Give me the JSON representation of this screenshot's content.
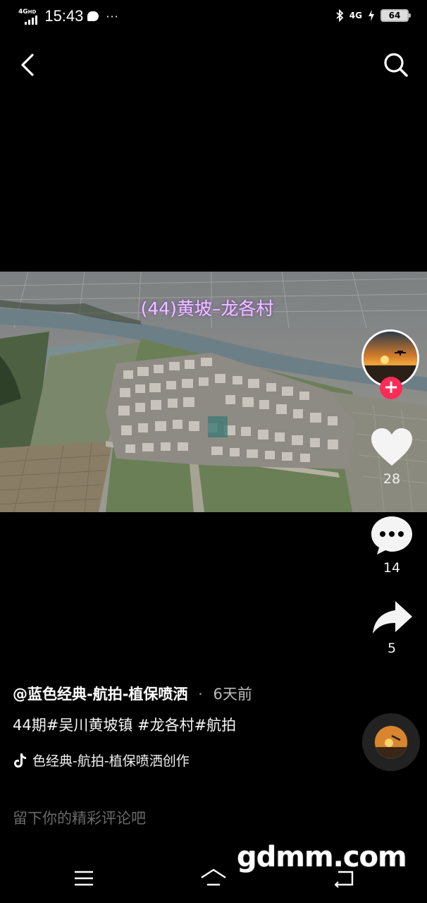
{
  "status_bar": {
    "network": "4G",
    "network_hd": "HD",
    "time": "15:43",
    "more": "···",
    "mobile_data": "4G",
    "battery": "64"
  },
  "video": {
    "caption": "(44)黄坡–龙各村"
  },
  "actions": {
    "like_count": "28",
    "comment_count": "14",
    "share_count": "5",
    "follow_symbol": "+"
  },
  "post": {
    "author": "@蓝色经典-航拍-植保喷洒",
    "separator": "·",
    "time_ago": "6天前",
    "description": "44期#吴川黄坡镇 #龙各村#航拍",
    "music": "色经典-航拍-植保喷洒创作"
  },
  "comment": {
    "placeholder": "留下你的精彩评论吧"
  },
  "watermark": "gdmm.com",
  "icons": {
    "back": "chevron-left-icon",
    "search": "search-icon",
    "like": "heart-icon",
    "comment": "speech-bubble-icon",
    "share": "share-arrow-icon",
    "music": "tiktok-note-icon"
  },
  "colors": {
    "background": "#000000",
    "follow_button": "#fe2c55",
    "caption": "#e7c8ff",
    "placeholder": "#6a6a6a"
  }
}
